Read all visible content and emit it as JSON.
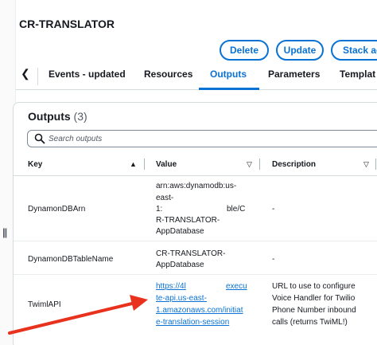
{
  "stack": {
    "title": "CR-TRANSLATOR",
    "actions": {
      "delete": "Delete",
      "update": "Update",
      "stack_actions": "Stack ac"
    }
  },
  "tabs": {
    "items": [
      "Events - updated",
      "Resources",
      "Outputs",
      "Parameters",
      "Templat"
    ],
    "active": "Outputs"
  },
  "outputs": {
    "title": "Outputs",
    "count": "(3)",
    "search_placeholder": "Search outputs",
    "columns": {
      "key": "Key",
      "value": "Value",
      "description": "Description"
    },
    "rows": [
      {
        "key": "DynamonDBArn",
        "value_lines": [
          "arn:aws:dynamodb:us-",
          "east-",
          "1:",
          "ble/C",
          "R-TRANSLATOR-",
          "AppDatabase"
        ],
        "description": "-"
      },
      {
        "key": "DynamonDBTableName",
        "value_lines": [
          "CR-TRANSLATOR-",
          "AppDatabase"
        ],
        "description": "-"
      },
      {
        "key": "TwimlAPI",
        "value_link_lines": [
          "https://4l",
          "execu",
          "te-api.us-east-",
          "1.amazonaws.com/initiat",
          "e-translation-session"
        ],
        "description_lines": [
          "URL to use to configure",
          "Voice Handler for Twilio",
          "Phone Number inbound",
          "calls (returns TwiML!)"
        ]
      }
    ]
  },
  "colors": {
    "accent": "#0972d3",
    "annotation_arrow": "#e8321e"
  },
  "icons": [
    "chevron-left-icon",
    "search-icon",
    "sort-triangle-icon",
    "sort-caret-icon",
    "drag-handle-icon"
  ]
}
